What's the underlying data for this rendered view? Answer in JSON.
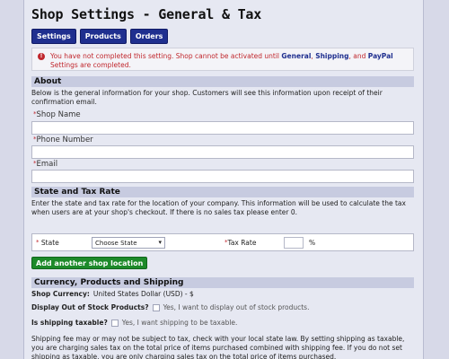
{
  "page": {
    "title": "Shop Settings - General & Tax"
  },
  "tabs": [
    {
      "label": "Settings"
    },
    {
      "label": "Products"
    },
    {
      "label": "Orders"
    }
  ],
  "alert": {
    "icon": "error-icon",
    "icon_glyph": "!",
    "text_before": "You have not completed this setting. Shop cannot be activated until ",
    "link_general": "General",
    "sep1": ", ",
    "link_shipping": "Shipping",
    "sep2": ", and ",
    "link_paypal": "PayPal",
    "text_after": " Settings are completed."
  },
  "about": {
    "header": "About",
    "description": "Below is the general information for your shop. Customers will see this information upon receipt of their confirmation email.",
    "required_mark": "*",
    "fields": [
      {
        "label": "Shop Name",
        "value": ""
      },
      {
        "label": "Phone Number",
        "value": ""
      },
      {
        "label": "Email",
        "value": ""
      }
    ]
  },
  "state_tax": {
    "header": "State and Tax Rate",
    "description": "Enter the state and tax rate for the location of your company. This information will be used to calculate the tax when users are at your shop's checkout. If there is no sales tax please enter 0.",
    "state_label": "State",
    "state_value": "Choose State",
    "tax_label": "Tax Rate",
    "tax_value": "",
    "percent": "%",
    "add_button": "Add another shop location"
  },
  "currency": {
    "header": "Currency, Products and Shipping",
    "shop_currency_label": "Shop Currency:",
    "shop_currency_value": "United States Dollar (USD) - $",
    "out_of_stock_label": "Display Out of Stock Products?",
    "out_of_stock_option": "Yes, I want to display out of stock products.",
    "out_of_stock_checked": false,
    "shipping_taxable_label": "Is shipping taxable?",
    "shipping_taxable_option": "Yes, I want shipping to be taxable.",
    "shipping_taxable_checked": false,
    "shipping_note": "Shipping fee may or may not be subject to tax, check with your local state law. By setting shipping as taxable, you are charging sales tax on the total price of items purchased combined with shipping fee. If you do not set shipping as taxable, you are only charging sales tax on the total price of items purchased."
  }
}
